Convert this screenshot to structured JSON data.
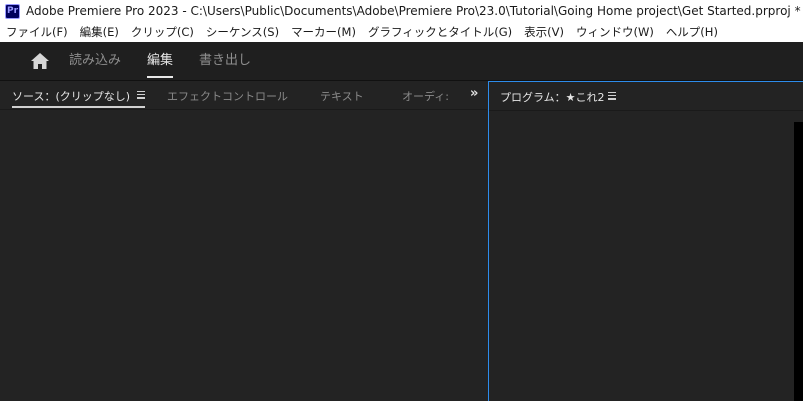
{
  "window": {
    "app_icon_label": "Pr",
    "title": "Adobe Premiere Pro 2023 - C:\\Users\\Public\\Documents\\Adobe\\Premiere Pro\\23.0\\Tutorial\\Going Home project\\Get Started.prproj *"
  },
  "menubar": {
    "items": [
      "ファイル(F)",
      "編集(E)",
      "クリップ(C)",
      "シーケンス(S)",
      "マーカー(M)",
      "グラフィックとタイトル(G)",
      "表示(V)",
      "ウィンドウ(W)",
      "ヘルプ(H)"
    ]
  },
  "workspace": {
    "home_icon": "home-icon",
    "tabs": [
      "読み込み",
      "編集",
      "書き出し"
    ],
    "active_tab": "編集"
  },
  "source_panel": {
    "tabs": [
      "ソース：(クリップなし)",
      "エフェクトコントロール",
      "テキスト",
      "オーディ:"
    ],
    "active_tab": "ソース：(クリップなし)",
    "overflow_icon": "double-chevron-right-icon"
  },
  "program_panel": {
    "title": "プログラム：★これ2",
    "accent_color": "#2d8ceb"
  }
}
